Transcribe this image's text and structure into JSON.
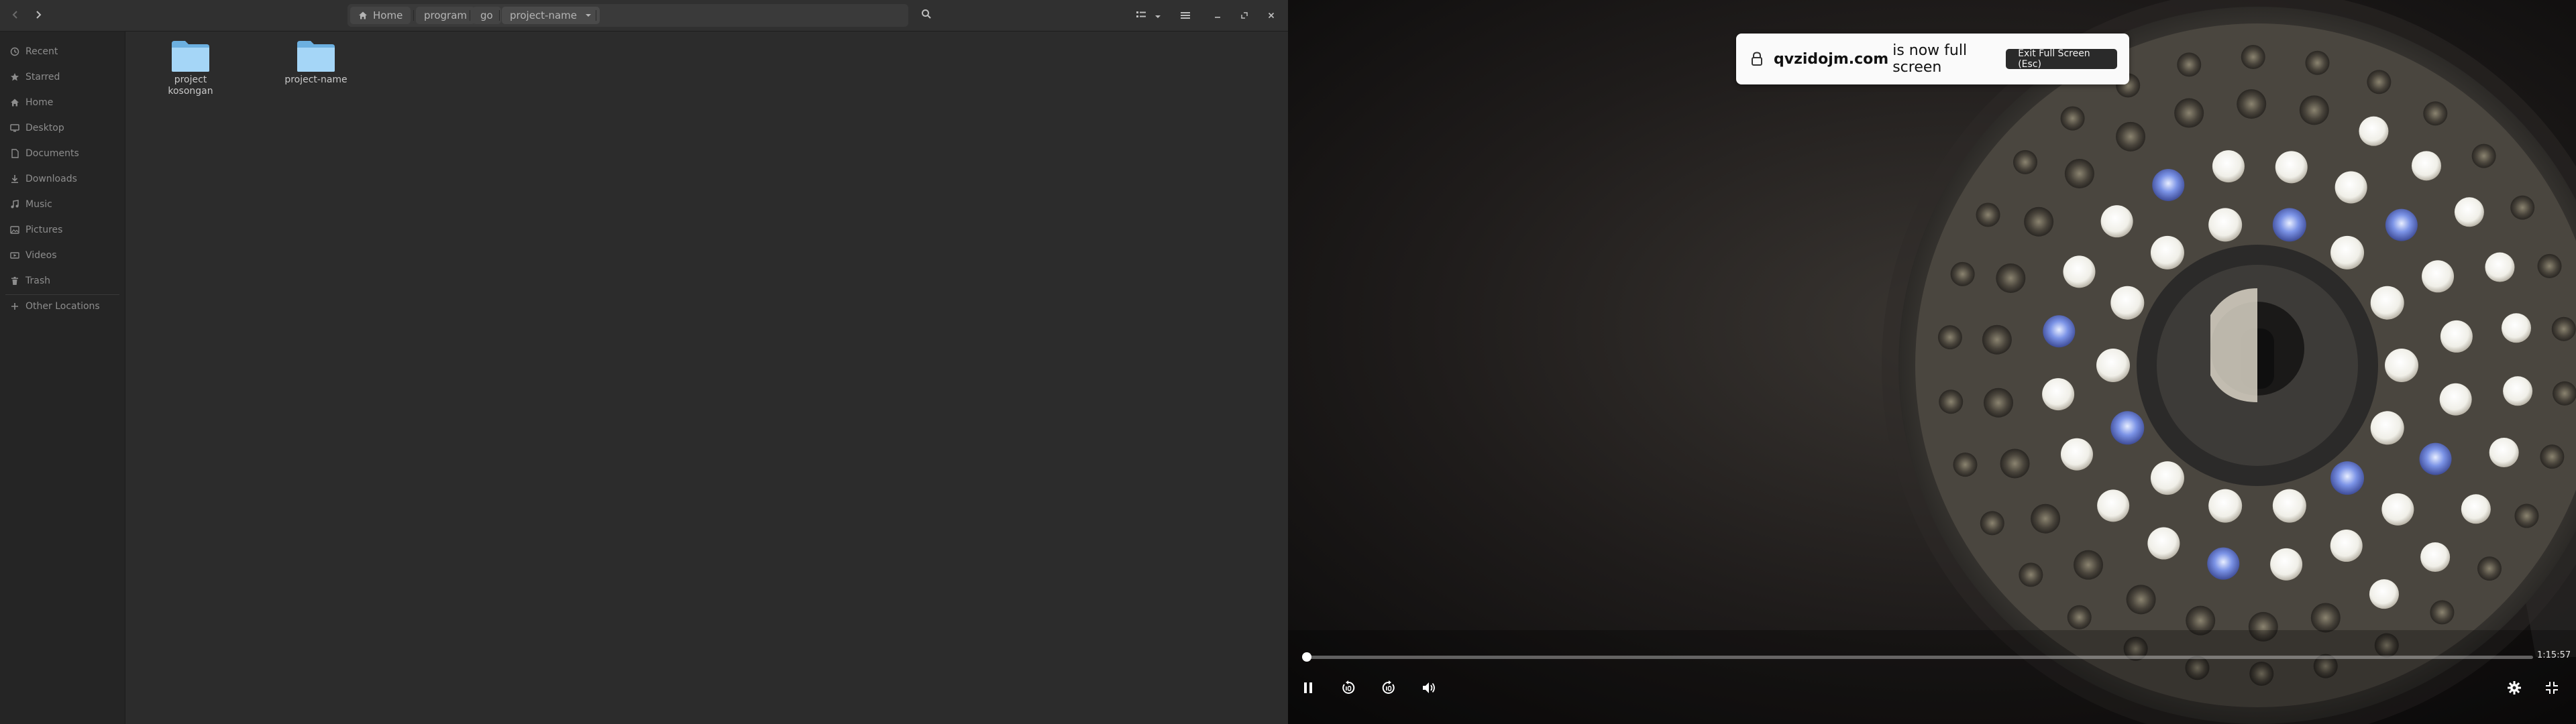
{
  "file_manager": {
    "path": {
      "home_label": "Home",
      "segments": [
        "program",
        "go",
        "project-name"
      ]
    },
    "sidebar": {
      "items": [
        {
          "label": "Recent",
          "icon": "clock-icon"
        },
        {
          "label": "Starred",
          "icon": "star-icon"
        },
        {
          "label": "Home",
          "icon": "home-icon"
        },
        {
          "label": "Desktop",
          "icon": "desktop-icon"
        },
        {
          "label": "Documents",
          "icon": "document-icon"
        },
        {
          "label": "Downloads",
          "icon": "download-icon"
        },
        {
          "label": "Music",
          "icon": "music-icon"
        },
        {
          "label": "Pictures",
          "icon": "picture-icon"
        },
        {
          "label": "Videos",
          "icon": "video-icon"
        },
        {
          "label": "Trash",
          "icon": "trash-icon"
        }
      ],
      "other_locations": "Other Locations"
    },
    "files": [
      {
        "name_line1": "project",
        "name_line2": "kosongan"
      },
      {
        "name_line1": "project-name",
        "name_line2": ""
      }
    ]
  },
  "video": {
    "fullscreen_notice": {
      "domain": "qvzidojm.com",
      "message": "is now full screen",
      "exit_label": "Exit Full Screen (Esc)"
    },
    "duration": "1:15:57",
    "progress_fraction": 0.002,
    "colors": {
      "notice_bg": "#fafafa",
      "exit_bg": "#2a2a2a",
      "progress": "#ffffff"
    }
  }
}
